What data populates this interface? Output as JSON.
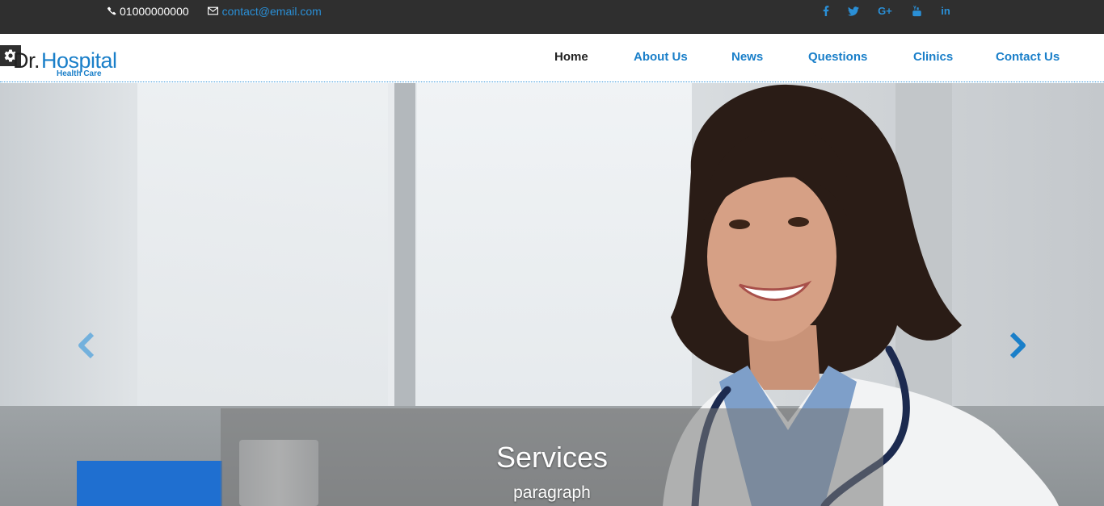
{
  "topbar": {
    "phone": "01000000000",
    "email": "contact@email.com",
    "social": [
      {
        "icon": "facebook-icon",
        "glyph": "f"
      },
      {
        "icon": "twitter-icon",
        "glyph": "t"
      },
      {
        "icon": "google-plus-icon",
        "glyph": "G+"
      },
      {
        "icon": "youtube-icon",
        "glyph": "yt"
      },
      {
        "icon": "linkedin-icon",
        "glyph": "in"
      }
    ]
  },
  "logo": {
    "dr": "Dr.",
    "hospital": "Hospital",
    "tagline": "Health Care"
  },
  "nav": {
    "items": [
      {
        "label": "Home",
        "active": true
      },
      {
        "label": "About Us",
        "active": false
      },
      {
        "label": "News",
        "active": false
      },
      {
        "label": "Questions",
        "active": false
      },
      {
        "label": "Clinics",
        "active": false
      },
      {
        "label": "Contact Us",
        "active": false
      }
    ]
  },
  "hero": {
    "caption_title": "Services",
    "caption_text": "paragraph"
  },
  "colors": {
    "accent": "#1a7fc9",
    "topbar": "#2f2f2f"
  }
}
